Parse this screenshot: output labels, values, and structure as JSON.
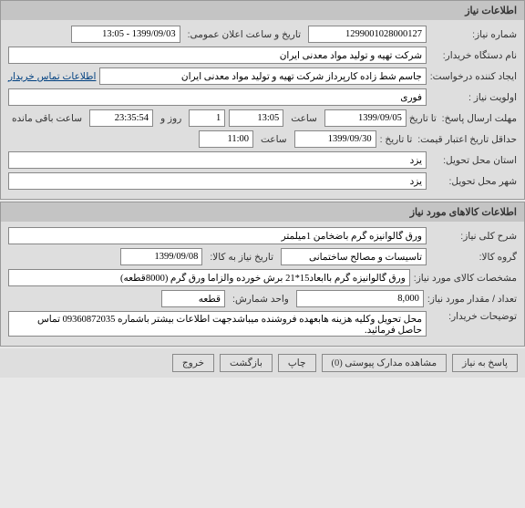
{
  "panel1": {
    "title": "اطلاعات نیاز",
    "need_number_label": "شماره نیاز:",
    "need_number": "1299001028000127",
    "announce_label": "تاریخ و ساعت اعلان عمومی:",
    "announce_value": "1399/09/03 - 13:05",
    "buyer_label": "نام دستگاه خریدار:",
    "buyer_value": "شرکت تهیه و تولید مواد معدنی ایران",
    "creator_label": "ایجاد کننده درخواست:",
    "creator_value": "جاسم شط زاده کارپرداز شرکت تهیه و تولید مواد معدنی ایران",
    "contact_link": "اطلاعات تماس خریدار",
    "priority_label": "اولویت نیاز :",
    "priority_value": "فوری",
    "deadline_label": "مهلت ارسال پاسخ:",
    "to_date_label": "تا تاریخ :",
    "deadline_date": "1399/09/05",
    "time_label": "ساعت",
    "deadline_time": "13:05",
    "day_count": "1",
    "day_label": "روز و",
    "remaining_time": "23:35:54",
    "remaining_label": "ساعت باقی مانده",
    "validity_label": "حداقل تاریخ اعتبار قیمت:",
    "validity_to_label": "تا تاریخ :",
    "validity_date": "1399/09/30",
    "validity_time": "11:00",
    "delivery_province_label": "استان محل تحویل:",
    "delivery_province": "یزد",
    "delivery_city_label": "شهر محل تحویل:",
    "delivery_city": "یزد"
  },
  "panel2": {
    "title": "اطلاعات کالاهای مورد نیاز",
    "desc_label": "شرح کلی نیاز:",
    "desc_value": "ورق گالوانیزه گرم باضخامن 1میلمتر",
    "group_label": "گروه کالا:",
    "group_value": "تاسیسات و مصالح ساختمانی",
    "need_date_label": "تاریخ نیاز به کالا:",
    "need_date": "1399/09/08",
    "spec_label": "مشخصات کالای مورد نیاز:",
    "spec_value": "ورق گالوانیزه گرم باابعاد15*21 برش خورده والزاما ورق گرم (8000قطعه)",
    "qty_label": "تعداد / مقدار مورد نیاز:",
    "qty_value": "8,000",
    "unit_label": "واحد شمارش:",
    "unit_value": "قطعه",
    "notes_label": "توضیحات خریدار:",
    "notes_value": "محل تحویل وکلیه هزینه هابعهده فروشنده میباشدجهت اطلاعات بیشتر باشماره 09360872035 تماس حاصل فرمائید."
  },
  "buttons": {
    "respond": "پاسخ به نیاز",
    "attachments": "مشاهده مدارک پیوستی (0)",
    "print": "چاپ",
    "back": "بازگشت",
    "exit": "خروج"
  }
}
